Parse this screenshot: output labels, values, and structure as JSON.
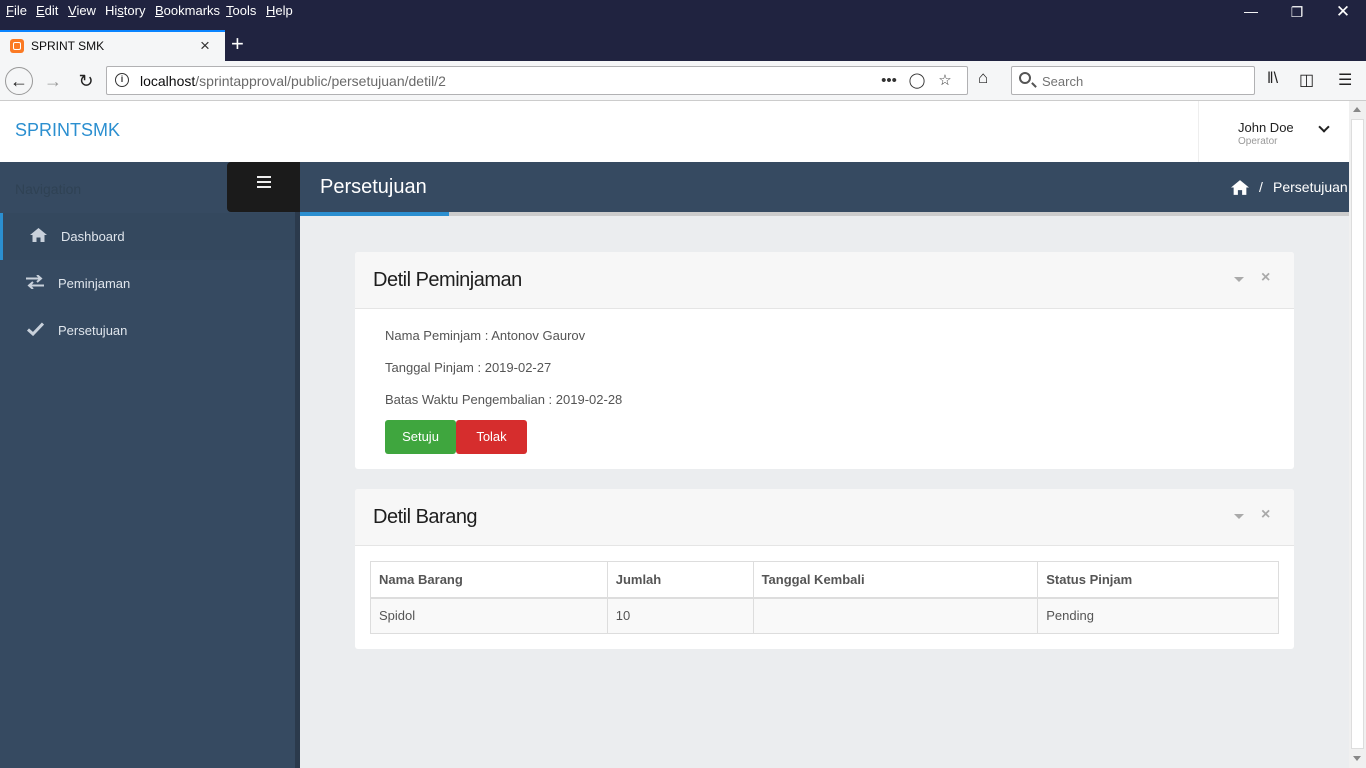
{
  "browser": {
    "menu": [
      "File",
      "Edit",
      "View",
      "History",
      "Bookmarks",
      "Tools",
      "Help"
    ],
    "menu_mnemonic": [
      "F",
      "E",
      "V",
      "s",
      "B",
      "T",
      "H"
    ],
    "tab_title": "SPRINT SMK",
    "url_host": "localhost",
    "url_path": "/sprintapproval/public/persetujuan/detil/2",
    "search_placeholder": "Search"
  },
  "app": {
    "brand": "SPRINTSMK",
    "user": {
      "name": "John Doe",
      "role": "Operator"
    }
  },
  "sidebar": {
    "title": "Navigation",
    "items": [
      {
        "label": "Dashboard",
        "icon": "home-icon",
        "active": true
      },
      {
        "label": "Peminjaman",
        "icon": "exchange-icon",
        "active": false
      },
      {
        "label": "Persetujuan",
        "icon": "check-icon",
        "active": false
      }
    ]
  },
  "content": {
    "page_title": "Persetujuan",
    "breadcrumb": {
      "separator": "/",
      "current": "Persetujuan"
    }
  },
  "detil_peminjaman": {
    "title": "Detil Peminjaman",
    "lines": [
      "Nama Peminjam : Antonov Gaurov",
      "Tanggal Pinjam : 2019-02-27",
      "Batas Waktu Pengembalian : 2019-02-28"
    ],
    "approve_label": "Setuju",
    "reject_label": "Tolak"
  },
  "detil_barang": {
    "title": "Detil Barang",
    "columns": [
      "Nama Barang",
      "Jumlah",
      "Tanggal Kembali",
      "Status Pinjam"
    ],
    "rows": [
      [
        "Spidol",
        "10",
        "",
        "Pending"
      ]
    ]
  },
  "colors": {
    "accent": "#2b8fd0",
    "sidebar_bg": "#364a61",
    "approve": "#3fa63e",
    "reject": "#d62d2d"
  }
}
